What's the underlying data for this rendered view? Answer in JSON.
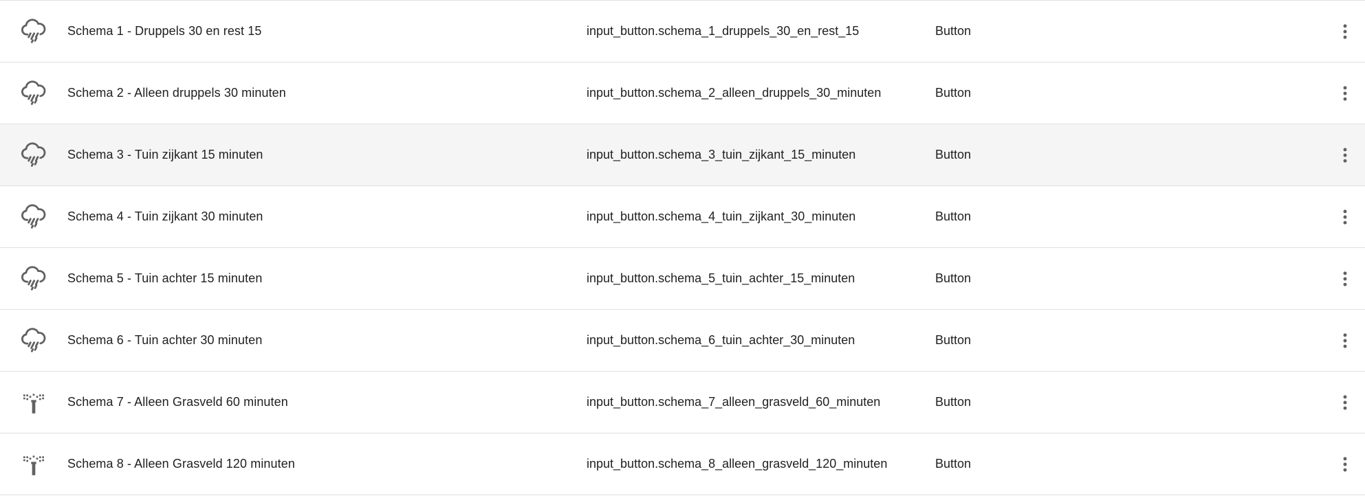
{
  "colors": {
    "icon": "#616161",
    "text": "#212121",
    "divider": "#e0e0e0",
    "hover_row": "#f5f5f5"
  },
  "rows": [
    {
      "icon": "weather-pouring-icon",
      "name": "Schema 1 - Druppels 30 en rest 15",
      "entity_id": "input_button.schema_1_druppels_30_en_rest_15",
      "domain": "Button"
    },
    {
      "icon": "weather-pouring-icon",
      "name": "Schema 2 - Alleen druppels 30 minuten",
      "entity_id": "input_button.schema_2_alleen_druppels_30_minuten",
      "domain": "Button"
    },
    {
      "icon": "weather-pouring-icon",
      "name": "Schema 3 - Tuin zijkant 15 minuten",
      "entity_id": "input_button.schema_3_tuin_zijkant_15_minuten",
      "domain": "Button"
    },
    {
      "icon": "weather-pouring-icon",
      "name": "Schema 4 - Tuin zijkant 30 minuten",
      "entity_id": "input_button.schema_4_tuin_zijkant_30_minuten",
      "domain": "Button"
    },
    {
      "icon": "weather-pouring-icon",
      "name": "Schema 5 - Tuin achter 15 minuten",
      "entity_id": "input_button.schema_5_tuin_achter_15_minuten",
      "domain": "Button"
    },
    {
      "icon": "weather-pouring-icon",
      "name": "Schema 6 - Tuin achter 30 minuten",
      "entity_id": "input_button.schema_6_tuin_achter_30_minuten",
      "domain": "Button"
    },
    {
      "icon": "sprinkler-icon",
      "name": "Schema 7 - Alleen Grasveld 60 minuten",
      "entity_id": "input_button.schema_7_alleen_grasveld_60_minuten",
      "domain": "Button"
    },
    {
      "icon": "sprinkler-icon",
      "name": "Schema 8 - Alleen Grasveld 120 minuten",
      "entity_id": "input_button.schema_8_alleen_grasveld_120_minuten",
      "domain": "Button"
    }
  ]
}
